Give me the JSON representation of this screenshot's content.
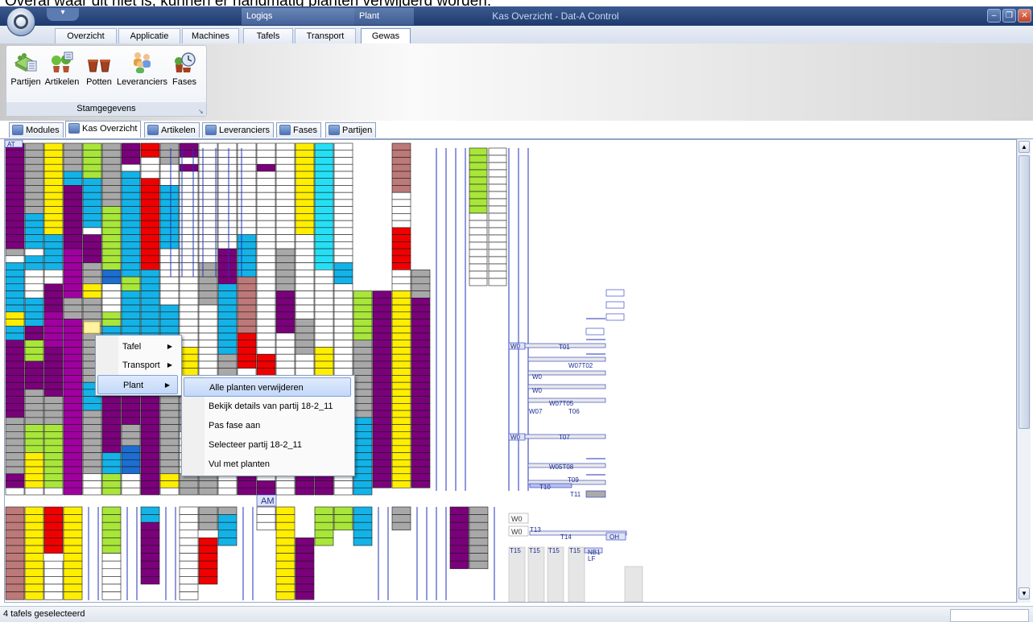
{
  "caption": "Overal waar dit niet is, kunnen er handmatig planten verwijderd worden.",
  "titlebar": {
    "title": "Kas Overzicht - Dat-A Control",
    "context_groups": [
      "Logiqs",
      "Plant"
    ],
    "window_buttons": [
      "minimize-icon",
      "restore-icon",
      "close-icon"
    ]
  },
  "ribbon_tabs": [
    {
      "label": "Overzicht"
    },
    {
      "label": "Applicatie"
    },
    {
      "label": "Machines"
    },
    {
      "label": "Tafels"
    },
    {
      "label": "Transport"
    },
    {
      "label": "Gewas",
      "active": true
    }
  ],
  "ribbon": {
    "group_label": "Stamgegevens",
    "buttons": [
      {
        "label": "Partijen",
        "icon": "batches-icon"
      },
      {
        "label": "Artikelen",
        "icon": "plants-icon"
      },
      {
        "label": "Potten",
        "icon": "pots-icon"
      },
      {
        "label": "Leveranciers",
        "icon": "suppliers-icon"
      },
      {
        "label": "Fases",
        "icon": "phases-icon"
      }
    ]
  },
  "doc_tabs": [
    {
      "label": "Modules"
    },
    {
      "label": "Kas Overzicht",
      "active": true
    },
    {
      "label": "Artikelen"
    },
    {
      "label": "Leveranciers"
    },
    {
      "label": "Fases"
    },
    {
      "label": "Partijen"
    }
  ],
  "greenhouse": {
    "labels": {
      "corner": "AT",
      "aisle": "AM",
      "w0": "W0",
      "t01": "T01",
      "w07t02": "W07T02",
      "w07t05": "W07T05",
      "w07": "W07",
      "t06": "T06",
      "t07": "T07",
      "w05t08": "W05T08",
      "t09": "T09",
      "t10": "T10",
      "t11": "T11",
      "t13": "T13",
      "t14": "T14",
      "oh": "OH",
      "t15": "T15",
      "nb1": "NB1",
      "lf": "LF"
    },
    "colors": {
      "purple": "#7b007b",
      "magenta": "#a000a0",
      "gray": "#a8a8a8",
      "yellow": "#ffee00",
      "lime": "#a8e63a",
      "cyan": "#13b3e8",
      "aqua": "#25e0f5",
      "red": "#f00000",
      "rose": "#bd7878",
      "blue": "#1c6ed0",
      "white": "#ffffff",
      "outline": "#2233bb"
    }
  },
  "context_menu": {
    "items": [
      {
        "label": "Tafel",
        "has_submenu": true
      },
      {
        "label": "Transport",
        "has_submenu": true
      },
      {
        "label": "Plant",
        "has_submenu": true,
        "highlighted": true
      }
    ],
    "submenu": [
      {
        "label": "Alle planten verwijderen",
        "highlighted": true
      },
      {
        "label": "Bekijk details van partij 18-2_11"
      },
      {
        "label": "Pas fase aan"
      },
      {
        "label": "Selecteer partij 18-2_11"
      },
      {
        "label": "Vul met planten"
      }
    ]
  },
  "statusbar": {
    "text": "4 tafels geselecteerd"
  }
}
